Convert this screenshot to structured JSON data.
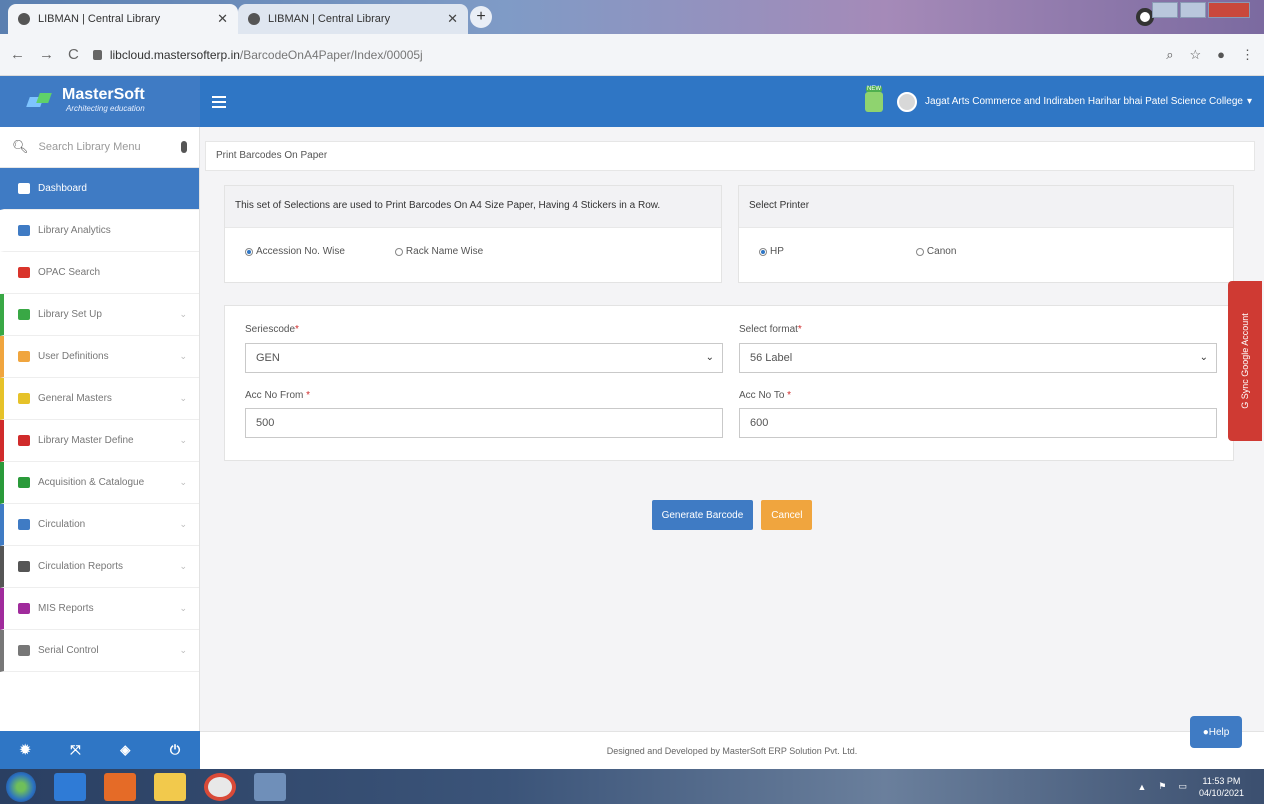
{
  "browser": {
    "tabs": [
      {
        "title": "LIBMAN | Central Library"
      },
      {
        "title": "LIBMAN | Central Library"
      }
    ],
    "url_host": "libcloud.mastersofterp.in",
    "url_path": "/BarcodeOnA4Paper/Index/00005j"
  },
  "app": {
    "brand": "MasterSoft",
    "brand_tagline": "Architecting education",
    "user_college": "Jagat Arts Commerce and Indiraben Harihar bhai Patel Science College",
    "notif_badge": "NEW"
  },
  "sidebar": {
    "search_placeholder": "Search Library Menu",
    "items": [
      {
        "label": "Dashboard",
        "icon": "home-icon",
        "color": "#ffffff"
      },
      {
        "label": "Library Analytics",
        "icon": "bar-chart-icon",
        "color": "#3f7bc4"
      },
      {
        "label": "OPAC Search",
        "icon": "search-icon",
        "color": "#d9342b"
      },
      {
        "label": "Library Set Up",
        "icon": "gears-icon",
        "color": "#39a845"
      },
      {
        "label": "User Definitions",
        "icon": "users-icon",
        "color": "#f0a53e"
      },
      {
        "label": "General Masters",
        "icon": "pencil-icon",
        "color": "#e6c229"
      },
      {
        "label": "Library Master Define",
        "icon": "sitemap-icon",
        "color": "#d02b2b"
      },
      {
        "label": "Acquisition & Catalogue",
        "icon": "book-icon",
        "color": "#2a9a3a"
      },
      {
        "label": "Circulation",
        "icon": "refresh-icon",
        "color": "#3f7bc4"
      },
      {
        "label": "Circulation Reports",
        "icon": "area-chart-icon",
        "color": "#555555"
      },
      {
        "label": "MIS Reports",
        "icon": "pie-chart-icon",
        "color": "#a02b9c"
      },
      {
        "label": "Serial Control",
        "icon": "copy-icon",
        "color": "#777777"
      }
    ]
  },
  "page": {
    "breadcrumb": "Print Barcodes On Paper",
    "selection_heading": "This set of Selections are used to Print Barcodes On A4 Size Paper, Having 4 Stickers in a Row.",
    "selection_options": [
      {
        "label": "Accession No. Wise",
        "checked": true
      },
      {
        "label": "Rack Name Wise",
        "checked": false
      }
    ],
    "printer_heading": "Select Printer",
    "printer_options": [
      {
        "label": "HP",
        "checked": true
      },
      {
        "label": "Canon",
        "checked": false
      }
    ],
    "form": {
      "seriescode_label": "Seriescode",
      "seriescode_value": "GEN",
      "format_label": "Select format",
      "format_value": "56 Label",
      "acc_from_label": "Acc No From",
      "acc_from_value": "500",
      "acc_to_label": "Acc No To",
      "acc_to_value": "600",
      "required_mark": "*"
    },
    "buttons": {
      "generate": "Generate Barcode",
      "cancel": "Cancel"
    },
    "footer": "Designed and Developed by MasterSoft ERP Solution Pvt. Ltd.",
    "help": "Help",
    "sync_tab": "Sync Google Account"
  },
  "taskbar": {
    "time": "11:53 PM",
    "date": "04/10/2021"
  }
}
